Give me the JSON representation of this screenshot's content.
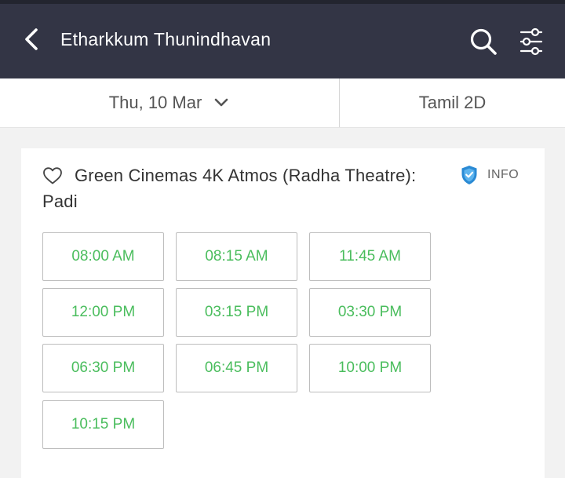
{
  "header": {
    "title": "Etharkkum Thunindhavan",
    "background_color": "#333545"
  },
  "selectors": {
    "date": "Thu, 10 Mar",
    "format": "Tamil 2D"
  },
  "cinema": {
    "name": "Green Cinemas 4K Atmos (Radha Theatre): Padi",
    "info_label": "INFO",
    "available_color": "#4abd5d",
    "shield_color": "#2a8ad4",
    "showtimes": [
      "08:00 AM",
      "08:15 AM",
      "11:45 AM",
      "12:00 PM",
      "03:15 PM",
      "03:30 PM",
      "06:30 PM",
      "06:45 PM",
      "10:00 PM",
      "10:15 PM"
    ]
  }
}
